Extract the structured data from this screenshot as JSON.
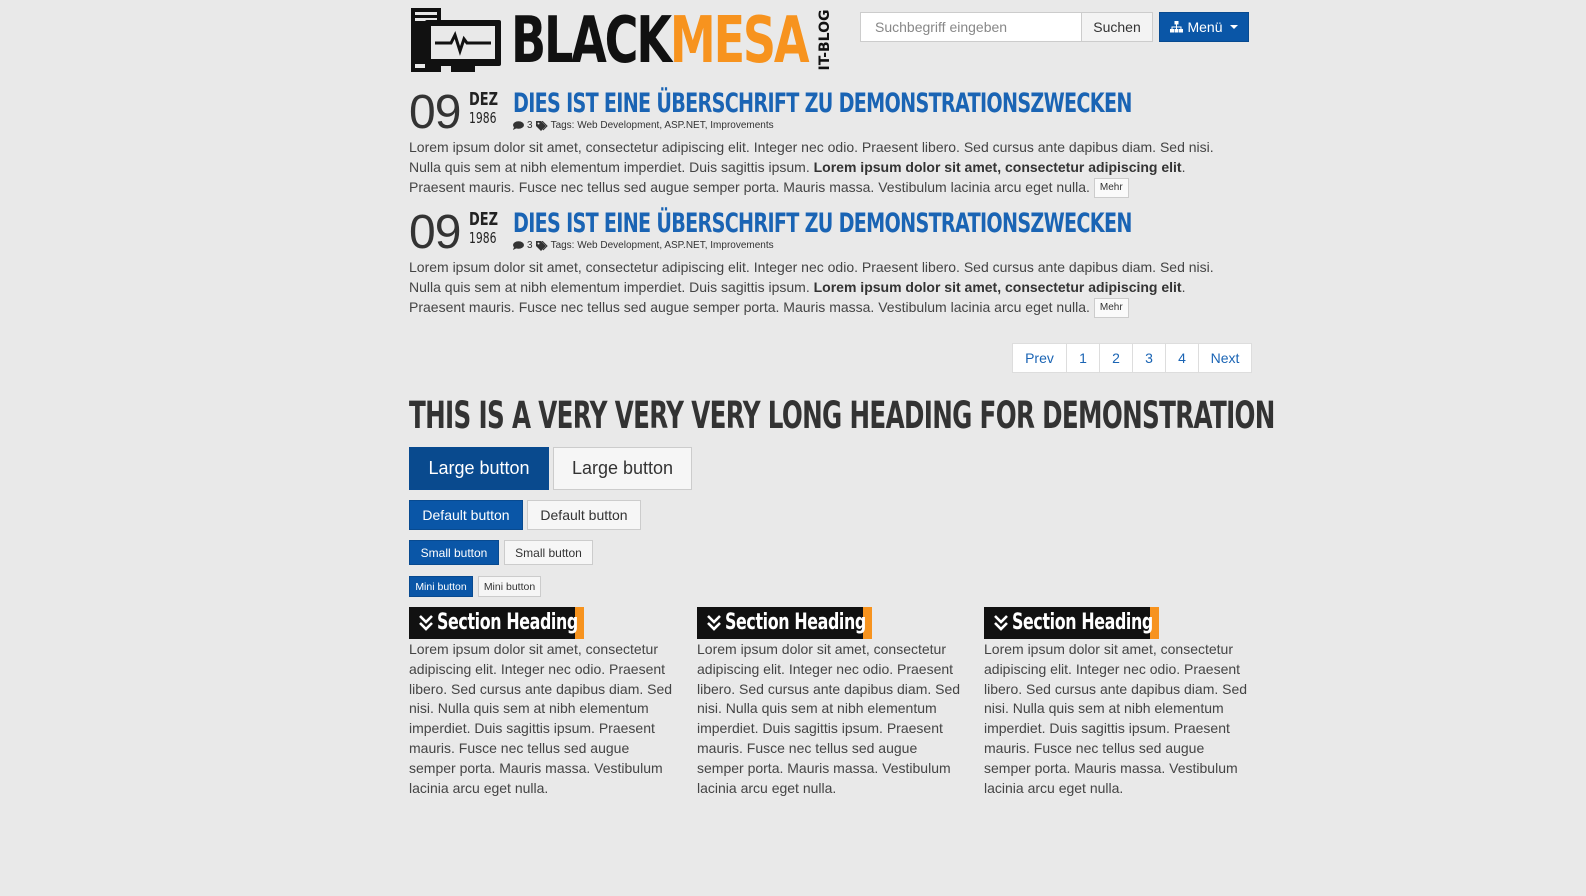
{
  "header": {
    "logo_black": "BLACK",
    "logo_mesa": "MESA",
    "logo_sub": "IT-BLOG",
    "search_placeholder": "Suchbegriff eingeben",
    "search_button": "Suchen",
    "menu_button": "Menü"
  },
  "posts": [
    {
      "day": "09",
      "month": "DEZ",
      "year": "1986",
      "title": "Dies ist eine Überschrift zu Demonstrationszwecken",
      "comments": "3",
      "tags": "Tags: Web Development, ASP.NET, Improvements",
      "body_1": "Lorem ipsum dolor sit amet, consectetur adipiscing elit. Integer nec odio. Praesent libero. Sed cursus ante dapibus diam. Sed nisi. Nulla quis sem at nibh elementum imperdiet. Duis sagittis ipsum. ",
      "body_bold": "Lorem ipsum dolor sit amet, consectetur adipiscing elit",
      "body_2": ". Praesent mauris. Fusce nec tellus sed augue semper porta. Mauris massa. Vestibulum lacinia arcu eget nulla.",
      "more": "Mehr"
    },
    {
      "day": "09",
      "month": "DEZ",
      "year": "1986",
      "title": "Dies ist eine Überschrift zu Demonstrationszwecken",
      "comments": "3",
      "tags": "Tags: Web Development, ASP.NET, Improvements",
      "body_1": "Lorem ipsum dolor sit amet, consectetur adipiscing elit. Integer nec odio. Praesent libero. Sed cursus ante dapibus diam. Sed nisi. Nulla quis sem at nibh elementum imperdiet. Duis sagittis ipsum. ",
      "body_bold": "Lorem ipsum dolor sit amet, consectetur adipiscing elit",
      "body_2": ". Praesent mauris. Fusce nec tellus sed augue semper porta. Mauris massa. Vestibulum lacinia arcu eget nulla.",
      "more": "Mehr"
    }
  ],
  "pagination": {
    "prev": "Prev",
    "pages": [
      "1",
      "2",
      "3",
      "4"
    ],
    "next": "Next"
  },
  "demo": {
    "heading": "This is a very very very long heading for demonstration",
    "large_primary": "Large button",
    "large_default": "Large button",
    "default_primary": "Default button",
    "default_default": "Default button",
    "small_primary": "Small button",
    "small_default": "Small button",
    "mini_primary": "Mini button",
    "mini_default": "Mini button"
  },
  "sections": [
    {
      "heading": "Section Heading",
      "text": "Lorem ipsum dolor sit amet, consectetur adipiscing elit. Integer nec odio. Praesent libero. Sed cursus ante dapibus diam. Sed nisi. Nulla quis sem at nibh elementum imperdiet. Duis sagittis ipsum. Praesent mauris. Fusce nec tellus sed augue semper porta. Mauris massa. Vestibulum lacinia arcu eget nulla."
    },
    {
      "heading": "Section Heading",
      "text": "Lorem ipsum dolor sit amet, consectetur adipiscing elit. Integer nec odio. Praesent libero. Sed cursus ante dapibus diam. Sed nisi. Nulla quis sem at nibh elementum imperdiet. Duis sagittis ipsum. Praesent mauris. Fusce nec tellus sed augue semper porta. Mauris massa. Vestibulum lacinia arcu eget nulla."
    },
    {
      "heading": "Section Heading",
      "text": "Lorem ipsum dolor sit amet, consectetur adipiscing elit. Integer nec odio. Praesent libero. Sed cursus ante dapibus diam. Sed nisi. Nulla quis sem at nibh elementum imperdiet. Duis sagittis ipsum. Praesent mauris. Fusce nec tellus sed augue semper porta. Mauris massa. Vestibulum lacinia arcu eget nulla."
    }
  ],
  "colors": {
    "brand_blue": "#0a56a7",
    "link_blue": "#1a64b4",
    "accent_orange": "#f7931e",
    "background": "#e9e9e9"
  },
  "icons": [
    "monitor-pulse-icon",
    "sitemap-icon",
    "comment-icon",
    "tags-icon",
    "double-chevron-down-icon"
  ]
}
